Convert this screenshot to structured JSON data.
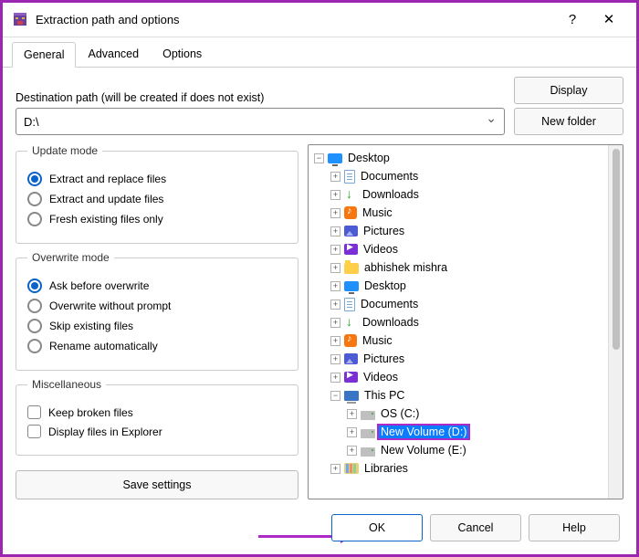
{
  "window": {
    "title": "Extraction path and options",
    "help_glyph": "?",
    "close_glyph": "✕"
  },
  "tabs": [
    "General",
    "Advanced",
    "Options"
  ],
  "active_tab": 0,
  "destination": {
    "label": "Destination path (will be created if does not exist)",
    "value": "D:\\",
    "display_btn": "Display",
    "newfolder_btn": "New folder"
  },
  "update_mode": {
    "legend": "Update mode",
    "options": [
      {
        "label": "Extract and replace files",
        "checked": true
      },
      {
        "label": "Extract and update files",
        "checked": false
      },
      {
        "label": "Fresh existing files only",
        "checked": false
      }
    ]
  },
  "overwrite_mode": {
    "legend": "Overwrite mode",
    "options": [
      {
        "label": "Ask before overwrite",
        "checked": true
      },
      {
        "label": "Overwrite without prompt",
        "checked": false
      },
      {
        "label": "Skip existing files",
        "checked": false
      },
      {
        "label": "Rename automatically",
        "checked": false
      }
    ]
  },
  "misc": {
    "legend": "Miscellaneous",
    "options": [
      {
        "label": "Keep broken files",
        "checked": false
      },
      {
        "label": "Display files in Explorer",
        "checked": false
      }
    ]
  },
  "save_settings_btn": "Save settings",
  "tree": [
    {
      "depth": 0,
      "icon": "desktop",
      "label": "Desktop",
      "exp": "minus"
    },
    {
      "depth": 1,
      "icon": "file",
      "label": "Documents",
      "exp": "plus"
    },
    {
      "depth": 1,
      "icon": "download",
      "label": "Downloads",
      "exp": "plus"
    },
    {
      "depth": 1,
      "icon": "music",
      "label": "Music",
      "exp": "plus"
    },
    {
      "depth": 1,
      "icon": "pictures",
      "label": "Pictures",
      "exp": "plus"
    },
    {
      "depth": 1,
      "icon": "videos",
      "label": "Videos",
      "exp": "plus"
    },
    {
      "depth": 1,
      "icon": "folder",
      "label": "abhishek mishra",
      "exp": "plus"
    },
    {
      "depth": 1,
      "icon": "desktop",
      "label": "Desktop",
      "exp": "plus"
    },
    {
      "depth": 1,
      "icon": "file",
      "label": "Documents",
      "exp": "plus"
    },
    {
      "depth": 1,
      "icon": "download",
      "label": "Downloads",
      "exp": "plus"
    },
    {
      "depth": 1,
      "icon": "music",
      "label": "Music",
      "exp": "plus"
    },
    {
      "depth": 1,
      "icon": "pictures",
      "label": "Pictures",
      "exp": "plus"
    },
    {
      "depth": 1,
      "icon": "videos",
      "label": "Videos",
      "exp": "plus"
    },
    {
      "depth": 1,
      "icon": "pc",
      "label": "This PC",
      "exp": "minus"
    },
    {
      "depth": 2,
      "icon": "drive",
      "label": "OS (C:)",
      "exp": "plus"
    },
    {
      "depth": 2,
      "icon": "drive",
      "label": "New Volume (D:)",
      "exp": "plus",
      "selected": true
    },
    {
      "depth": 2,
      "icon": "drive",
      "label": "New Volume (E:)",
      "exp": "plus"
    },
    {
      "depth": 1,
      "icon": "libs",
      "label": "Libraries",
      "exp": "plus"
    }
  ],
  "footer": {
    "ok": "OK",
    "cancel": "Cancel",
    "help": "Help"
  }
}
